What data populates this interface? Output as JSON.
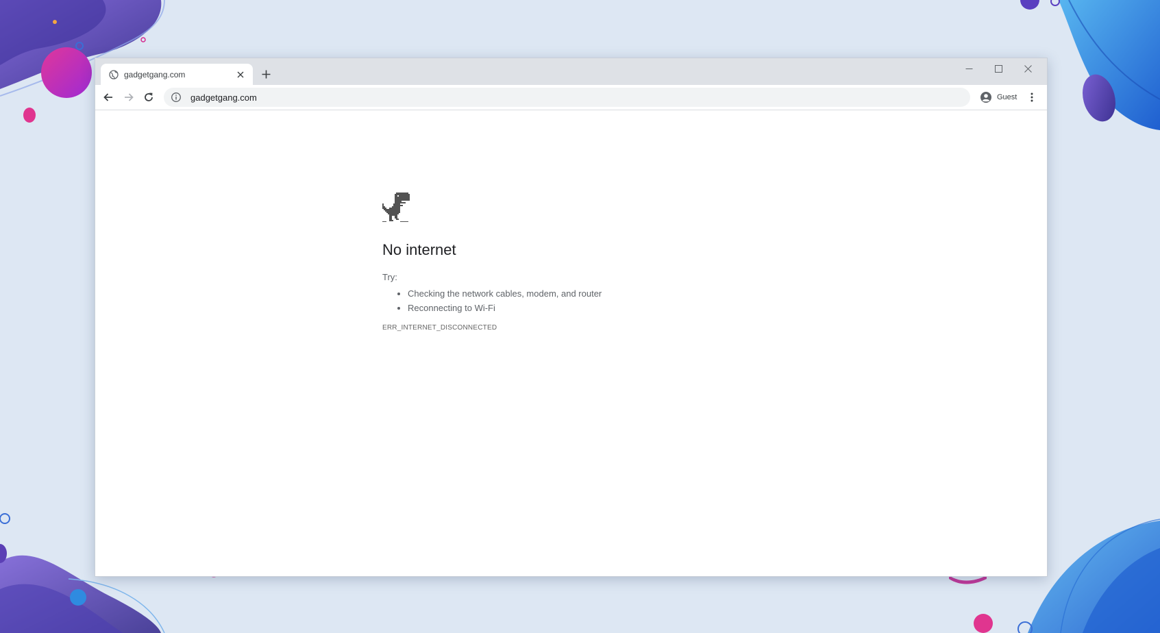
{
  "browser": {
    "tab": {
      "title": "gadgetgang.com",
      "favicon": "globe-icon"
    },
    "omnibox": {
      "url": "gadgetgang.com",
      "icon": "info-icon"
    },
    "profile": {
      "label": "Guest",
      "icon": "account-icon"
    }
  },
  "error_page": {
    "icon": "dinosaur-icon",
    "heading": "No internet",
    "try_label": "Try:",
    "suggestions": [
      "Checking the network cables, modem, and router",
      "Reconnecting to Wi-Fi"
    ],
    "error_code": "ERR_INTERNET_DISCONNECTED"
  },
  "colors": {
    "desktop_bg": "#dde7f3",
    "tabstrip_bg": "#dee1e6",
    "omnibox_bg": "#f1f3f4",
    "accent_magenta": "#d52a8f",
    "accent_blue": "#1f7fd6",
    "accent_purple": "#5b3fb5"
  }
}
